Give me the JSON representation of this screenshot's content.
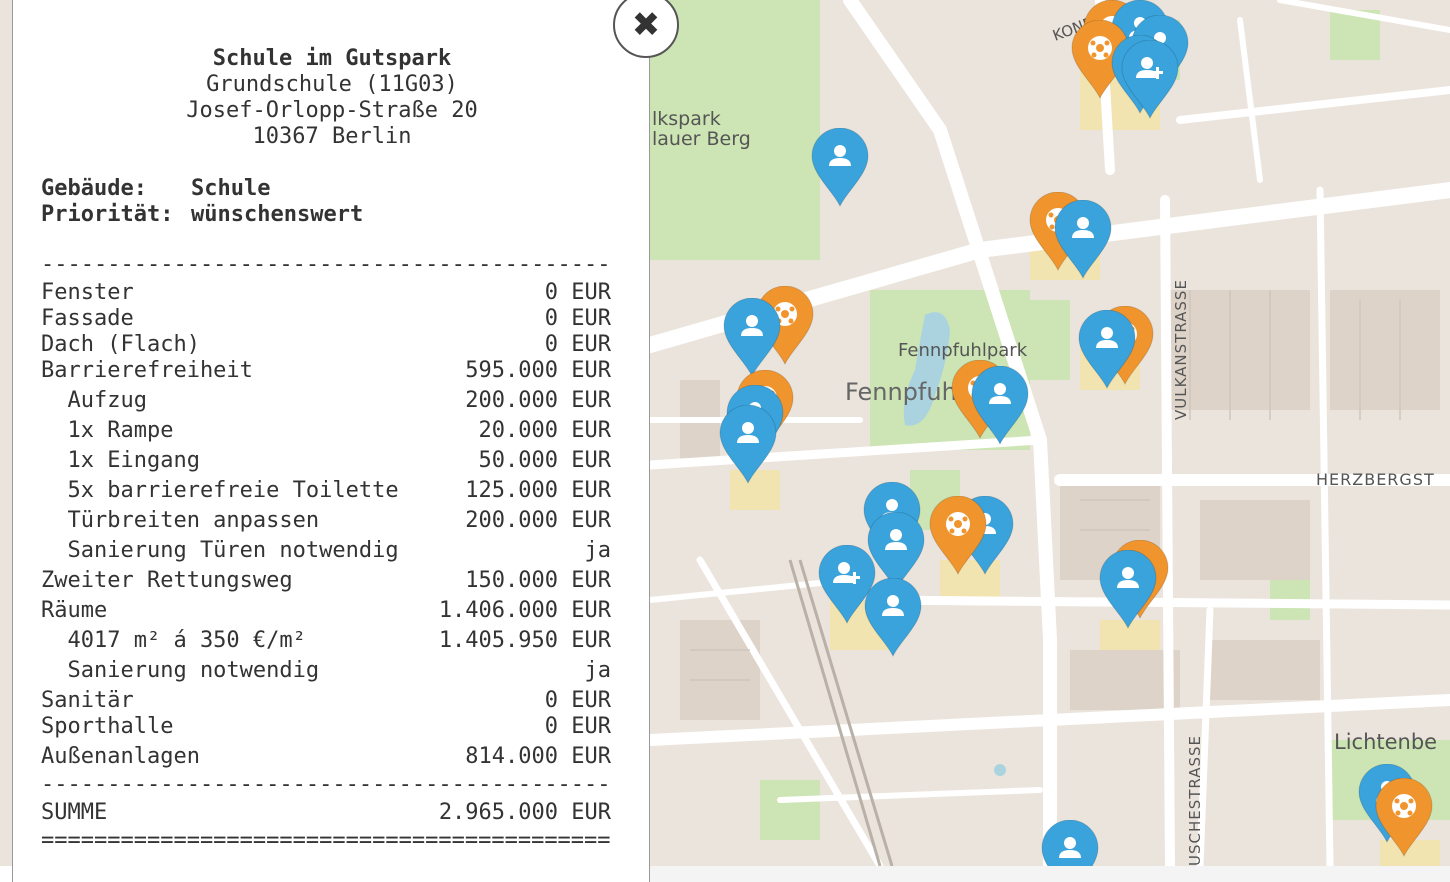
{
  "map": {
    "labels": {
      "park_left": "lkspark",
      "park_left2": "lauer Berg",
      "fennpfuhlpark": "Fennpfuhlpark",
      "fennpfuhl": "Fennpfuhl",
      "vulkanstrasse": "VULKANSTRASSE",
      "herzberg": "HERZBERGST",
      "lichtenberg": "Lichtenbe",
      "konrad": "KONR",
      "usche": "USCHESTRASSE"
    },
    "pin_colors": {
      "blue": "#3aa3dc",
      "orange": "#f0952e"
    }
  },
  "panel": {
    "school_name": "Schule im Gutspark",
    "school_type": "Grundschule (11G03)",
    "street": "Josef-Orlopp-Straße 20",
    "city": "10367 Berlin",
    "building_label": "Gebäude:",
    "building_value": "Schule",
    "priority_label": "Priorität:",
    "priority_value": "wünschenswert",
    "separator_dash": "-------------------------------------------",
    "separator_eq": "===========================================",
    "rows": [
      {
        "label": "Fenster",
        "value": "0 EUR"
      },
      {
        "label": "Fassade",
        "value": "0 EUR"
      },
      {
        "label": "Dach (Flach)",
        "value": "0 EUR"
      },
      {
        "label": "Barrierefreiheit",
        "value": "595.000 EUR"
      },
      {
        "label": "  Aufzug",
        "value": "200.000 EUR"
      },
      {
        "label": "  1x Rampe",
        "value": "20.000 EUR"
      },
      {
        "label": "  1x Eingang",
        "value": "50.000 EUR"
      },
      {
        "label": "  5x barrierefreie Toilette",
        "value": "125.000 EUR"
      },
      {
        "label": "  Türbreiten anpassen",
        "value": "200.000 EUR"
      },
      {
        "label": "  Sanierung Türen notwendig",
        "value": "ja"
      },
      {
        "label": "Zweiter Rettungsweg",
        "value": "150.000 EUR"
      },
      {
        "label": "Räume",
        "value": "1.406.000 EUR"
      },
      {
        "label": "  4017 m² á 350 €/m²",
        "value": "1.405.950 EUR"
      },
      {
        "label": "  Sanierung notwendig",
        "value": "ja"
      },
      {
        "label": "Sanitär",
        "value": "0 EUR"
      },
      {
        "label": "Sporthalle",
        "value": "0 EUR"
      },
      {
        "label": "Außenanlagen",
        "value": "814.000 EUR"
      }
    ],
    "sum_label": "SUMME",
    "sum_value": "2.965.000 EUR",
    "close_icon": "close-icon"
  }
}
